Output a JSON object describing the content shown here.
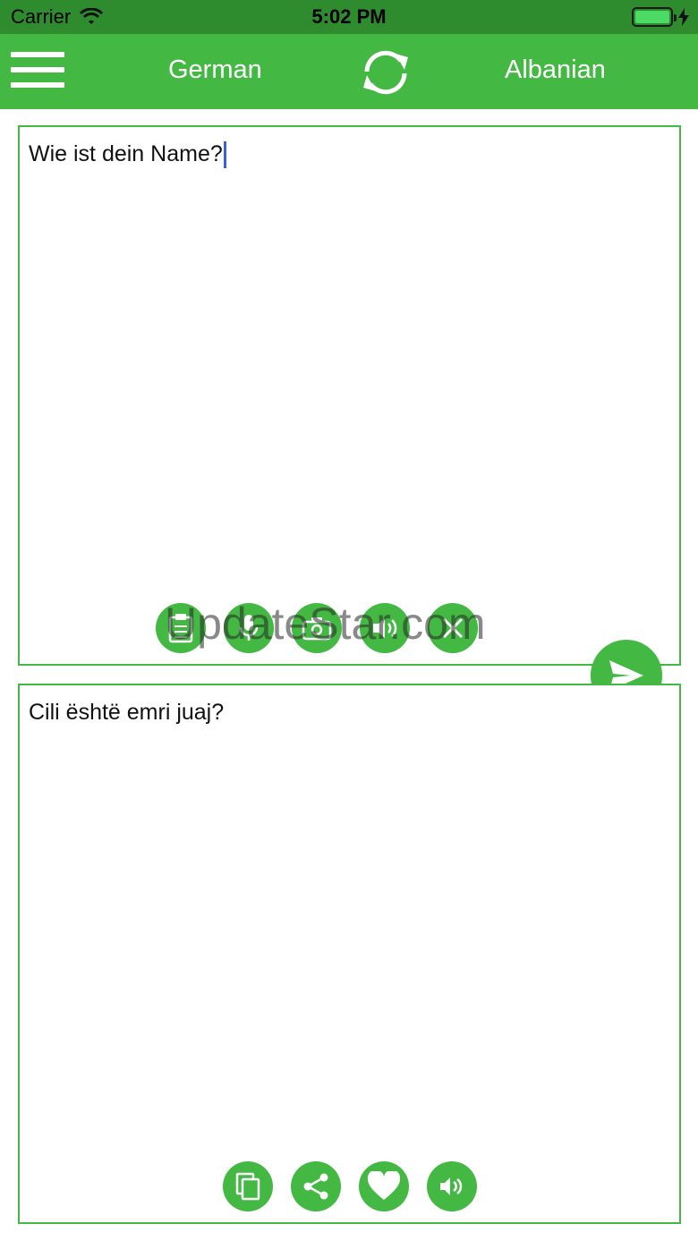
{
  "status": {
    "carrier": "Carrier",
    "time": "5:02 PM"
  },
  "toolbar": {
    "source_lang": "German",
    "target_lang": "Albanian"
  },
  "source": {
    "text": "Wie ist dein Name?"
  },
  "target": {
    "text": "Cili është emri juaj?"
  },
  "source_actions": [
    "clipboard-icon",
    "microphone-icon",
    "camera-icon",
    "speak-icon",
    "clear-icon"
  ],
  "target_actions": [
    "copy-icon",
    "share-icon",
    "favorite-icon",
    "speaker-icon"
  ],
  "watermark": "UpdateStar.com",
  "colors": {
    "accent": "#43b843",
    "status_bar": "#2e8b2e",
    "caret": "#3a5fd9"
  }
}
